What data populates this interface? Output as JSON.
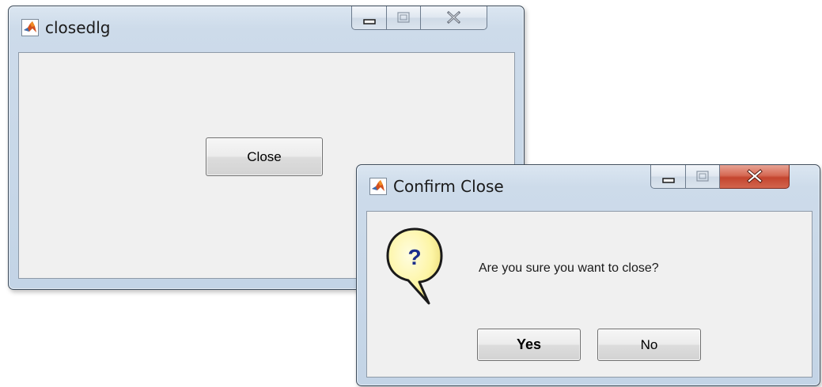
{
  "colors": {
    "client_background": "#f0f0f0",
    "title_bar": "#cddbea",
    "close_button_red": "#c4452f",
    "balloon_fill": "#fdf5a6",
    "question_mark": "#1c2f8c"
  },
  "main_window": {
    "title": "closedlg",
    "icon": "matlab-icon",
    "caption_buttons": [
      "minimize-icon",
      "maximize-icon",
      "close-icon"
    ],
    "close_button_label": "Close"
  },
  "confirm_dialog": {
    "title": "Confirm Close",
    "icon": "matlab-icon",
    "caption_buttons": [
      "minimize-icon",
      "maximize-icon",
      "close-icon"
    ],
    "status_icon": "question-icon",
    "question_glyph": "?",
    "message": "Are you sure you want to close?",
    "yes_label": "Yes",
    "no_label": "No"
  }
}
